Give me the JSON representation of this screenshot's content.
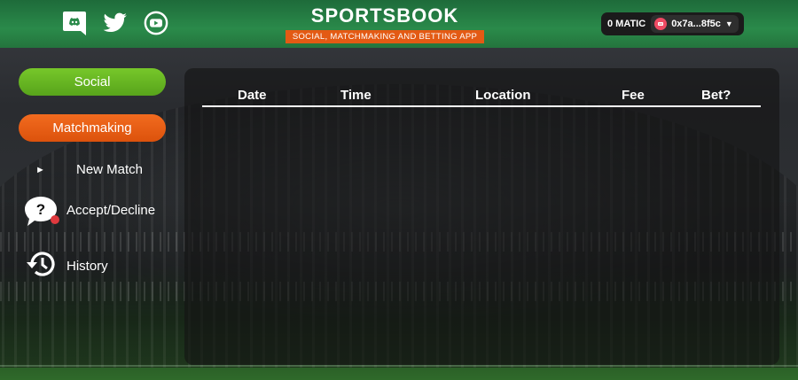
{
  "header": {
    "brand": "SPORTSBOOK",
    "tagline": "SOCIAL, MATCHMAKING AND BETTING APP",
    "social_icons": [
      "discord-icon",
      "twitter-icon",
      "youtube-icon"
    ]
  },
  "wallet": {
    "balance": "0 MATIC",
    "address": "0x7a...8f5c"
  },
  "sidebar": {
    "social_label": "Social",
    "matchmaking_label": "Matchmaking",
    "items": [
      {
        "label": "New Match",
        "icon": "play-arrow-icon"
      },
      {
        "label": "Accept/Decline",
        "icon": "question-bubble-icon"
      },
      {
        "label": "History",
        "icon": "history-icon"
      }
    ]
  },
  "table": {
    "columns": [
      "Date",
      "Time",
      "Location",
      "Fee",
      "Bet?"
    ],
    "rows": []
  },
  "colors": {
    "header_green": "#2a8a4a",
    "social_green": "#6bb823",
    "matchmaking_orange": "#e35a14",
    "notification_red": "#e0393e"
  }
}
